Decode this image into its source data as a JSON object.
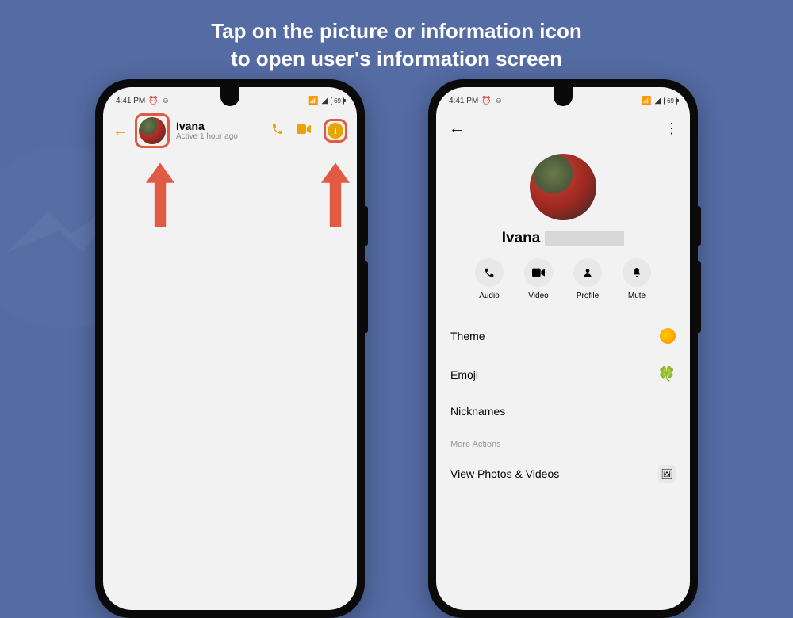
{
  "instruction": {
    "line1": "Tap on the picture or information icon",
    "line2": "to open user's information screen"
  },
  "status": {
    "time": "4:41 PM",
    "alarm_icon": "alarm-icon",
    "msg_icon": "message-icon",
    "wifi_icon": "wifi-icon",
    "signal_icon": "signal-icon",
    "battery": "69"
  },
  "chat": {
    "contact_name": "Ivana",
    "active_status": "Active 1 hour ago",
    "icons": {
      "call": "call",
      "video": "video",
      "info": "i"
    }
  },
  "info": {
    "name": "Ivana",
    "actions": [
      {
        "label": "Audio",
        "icon": "phone-icon"
      },
      {
        "label": "Video",
        "icon": "camera-icon"
      },
      {
        "label": "Profile",
        "icon": "person-icon"
      },
      {
        "label": "Mute",
        "icon": "bell-icon"
      }
    ],
    "rows": {
      "theme": "Theme",
      "emoji": "Emoji",
      "nicknames": "Nicknames",
      "more_actions": "More Actions",
      "view_photos": "View Photos & Videos"
    }
  }
}
